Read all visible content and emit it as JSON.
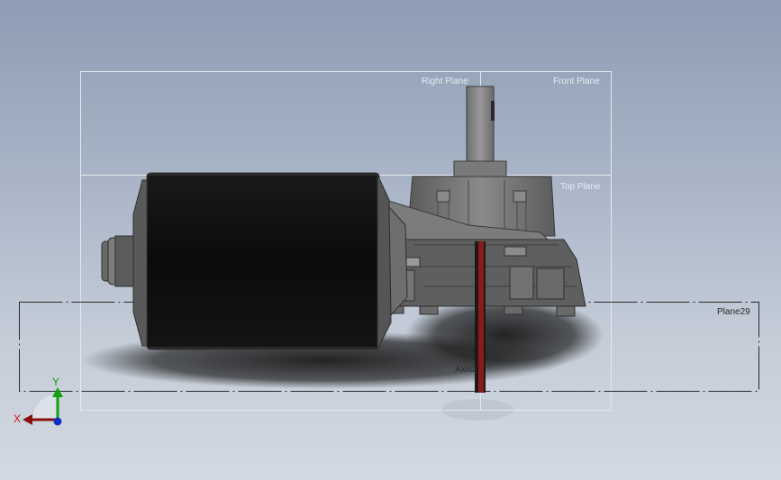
{
  "planes": {
    "right": "Right Plane",
    "front": "Front Plane",
    "top": "Top Plane",
    "plane29": "Plane29"
  },
  "axis": {
    "label": "Axis3"
  },
  "triad": {
    "x": "X",
    "y": "Y",
    "x_color": "#d01010",
    "y_color": "#10a010",
    "z_color": "#1030c0"
  },
  "colors": {
    "background_top": "#8e9db4",
    "background_bottom": "#d3d9e2",
    "motor_body": "#0b0b0b",
    "gearbox": "#6e6e6e",
    "axis_highlight": "#8b1a1a"
  }
}
